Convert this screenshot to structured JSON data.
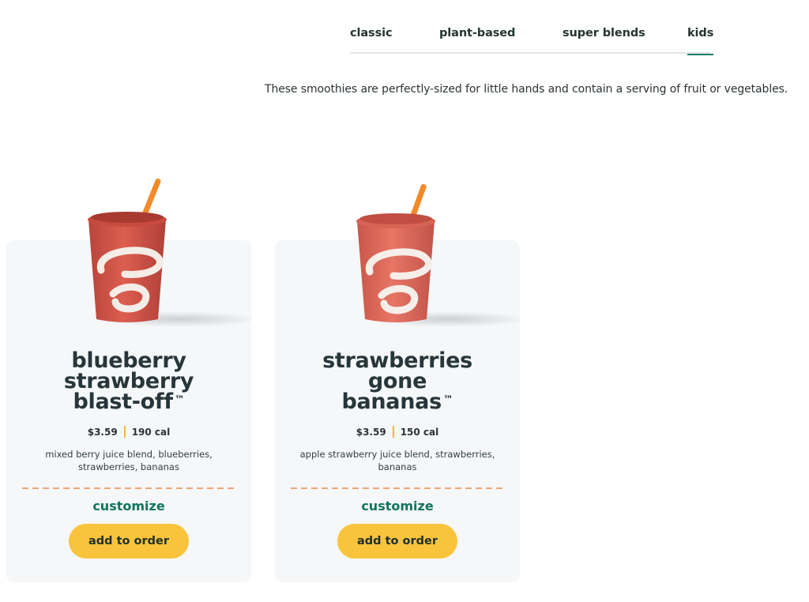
{
  "tabs": [
    {
      "label": "classic"
    },
    {
      "label": "plant-based"
    },
    {
      "label": "super blends"
    },
    {
      "label": "kids",
      "active": true
    }
  ],
  "intro": "These smoothies are perfectly-sized for little hands and contain a serving of fruit or vegetables.",
  "products": [
    {
      "name_lines": [
        "blueberry",
        "strawberry",
        "blast-off"
      ],
      "trademark": "™",
      "price": "$3.59",
      "calories": "190 cal",
      "ingredients": "mixed berry juice blend, blueberries, strawberries, bananas",
      "customize_label": "customize",
      "add_label": "add to order",
      "cup_color": "#d9574a"
    },
    {
      "name_lines": [
        "strawberries",
        "gone",
        "bananas"
      ],
      "trademark": "™",
      "price": "$3.59",
      "calories": "150 cal",
      "ingredients": "apple strawberry juice blend, strawberries, bananas",
      "customize_label": "customize",
      "add_label": "add to order",
      "cup_color": "#e06b5c"
    }
  ],
  "colors": {
    "accent_green": "#0f7560",
    "button_yellow": "#f9c43c",
    "divider_orange": "#f08a4b",
    "separator_yellow": "#f5b82e"
  }
}
